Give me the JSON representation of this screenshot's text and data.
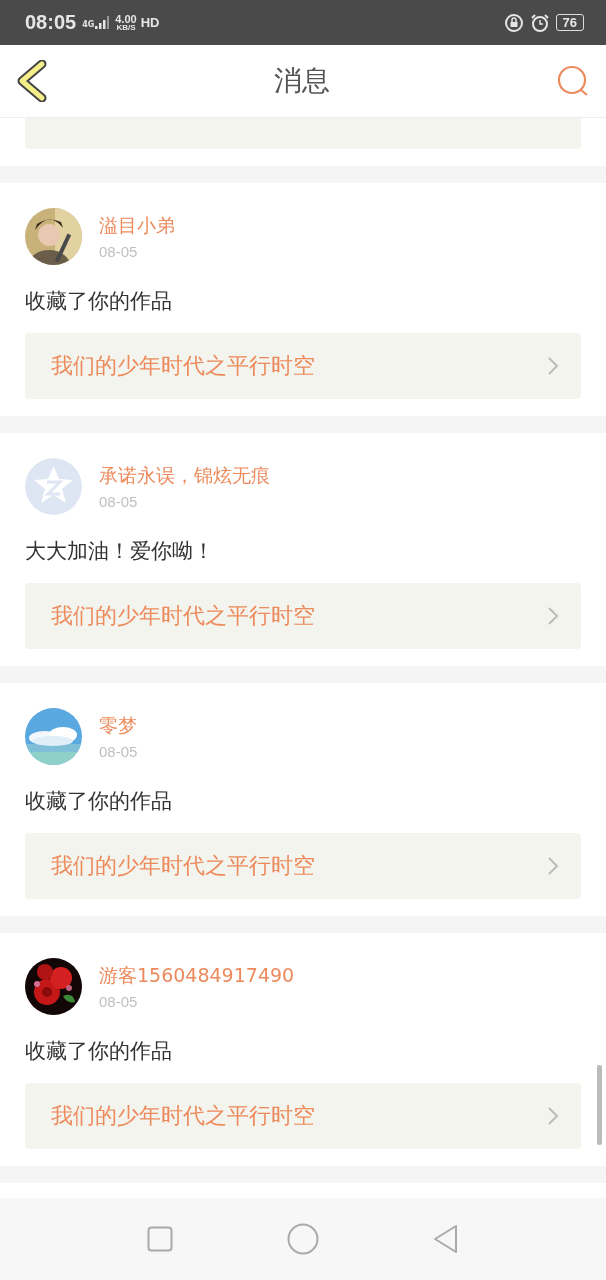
{
  "status_bar": {
    "time": "08:05",
    "network": "4G",
    "speed": "4.00",
    "speed_unit": "KB/S",
    "hd": "HD",
    "battery": "76"
  },
  "header": {
    "title": "消息"
  },
  "messages": [
    {
      "name": "溢目小弟",
      "date": "08-05",
      "text": "收藏了你的作品",
      "work": "我们的少年时代之平行时空"
    },
    {
      "avatar": {
        "kind": "default"
      },
      "name": "承诺永误，锦炫无痕",
      "date": "08-05",
      "text": "大大加油！爱你呦！",
      "work": "我们的少年时代之平行时空"
    },
    {
      "name": "零梦",
      "date": "08-05",
      "text": "收藏了你的作品",
      "work": "我们的少年时代之平行时空"
    },
    {
      "name": "游客1560484917490",
      "date": "08-05",
      "text": "收藏了你的作品",
      "work": "我们的少年时代之平行时空"
    }
  ]
}
